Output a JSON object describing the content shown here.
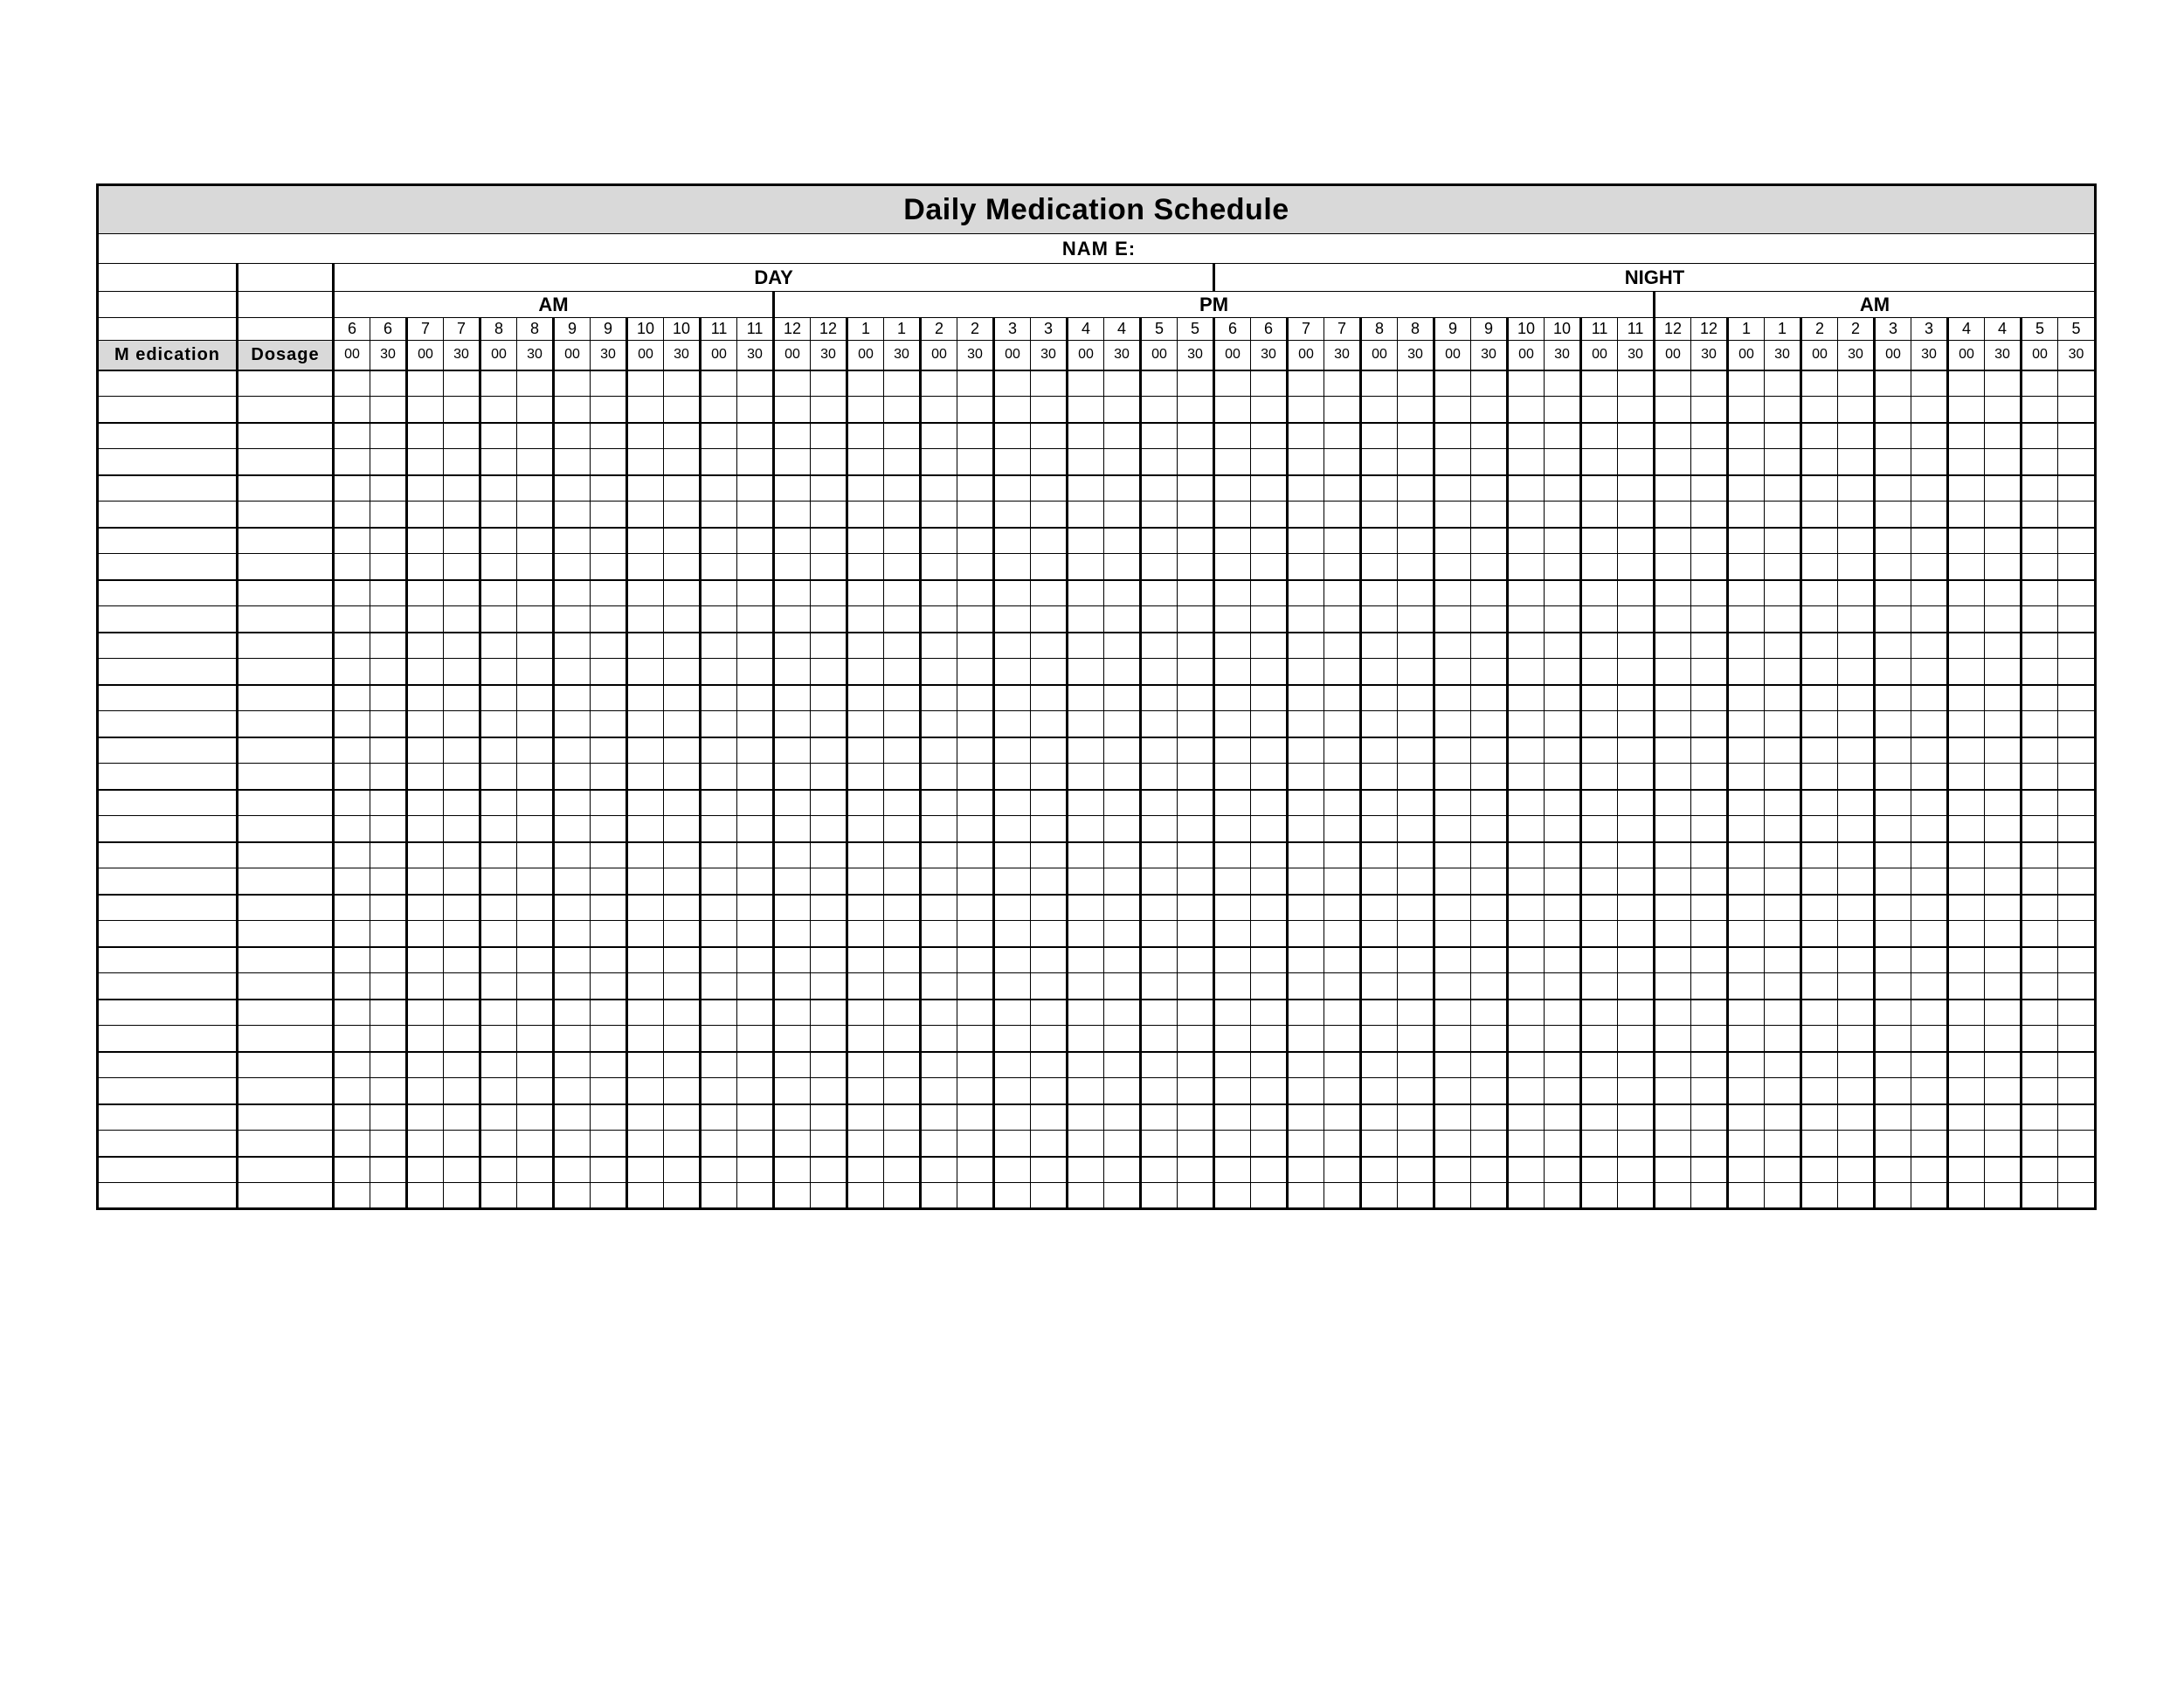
{
  "title": "Daily Medication Schedule",
  "name_label": "NAM E:",
  "day_label": "DAY",
  "night_label": "NIGHT",
  "periods": {
    "am": "AM",
    "pm": "PM"
  },
  "columns": {
    "medication": "M edication",
    "dosage": "Dosage"
  },
  "hours": [
    "6",
    "6",
    "7",
    "7",
    "8",
    "8",
    "9",
    "9",
    "10",
    "10",
    "11",
    "11",
    "12",
    "12",
    "1",
    "1",
    "2",
    "2",
    "3",
    "3",
    "4",
    "4",
    "5",
    "5",
    "6",
    "6",
    "7",
    "7",
    "8",
    "8",
    "9",
    "9",
    "10",
    "10",
    "11",
    "11",
    "12",
    "12",
    "1",
    "1",
    "2",
    "2",
    "3",
    "3",
    "4",
    "4",
    "5",
    "5"
  ],
  "minutes": [
    "00",
    "30",
    "00",
    "30",
    "00",
    "30",
    "00",
    "30",
    "00",
    "30",
    "00",
    "30",
    "00",
    "30",
    "00",
    "30",
    "00",
    "30",
    "00",
    "30",
    "00",
    "30",
    "00",
    "30",
    "00",
    "30",
    "00",
    "30",
    "00",
    "30",
    "00",
    "30",
    "00",
    "30",
    "00",
    "30",
    "00",
    "30",
    "00",
    "30",
    "00",
    "30",
    "00",
    "30",
    "00",
    "30",
    "00",
    "30"
  ],
  "data_rows": 32
}
